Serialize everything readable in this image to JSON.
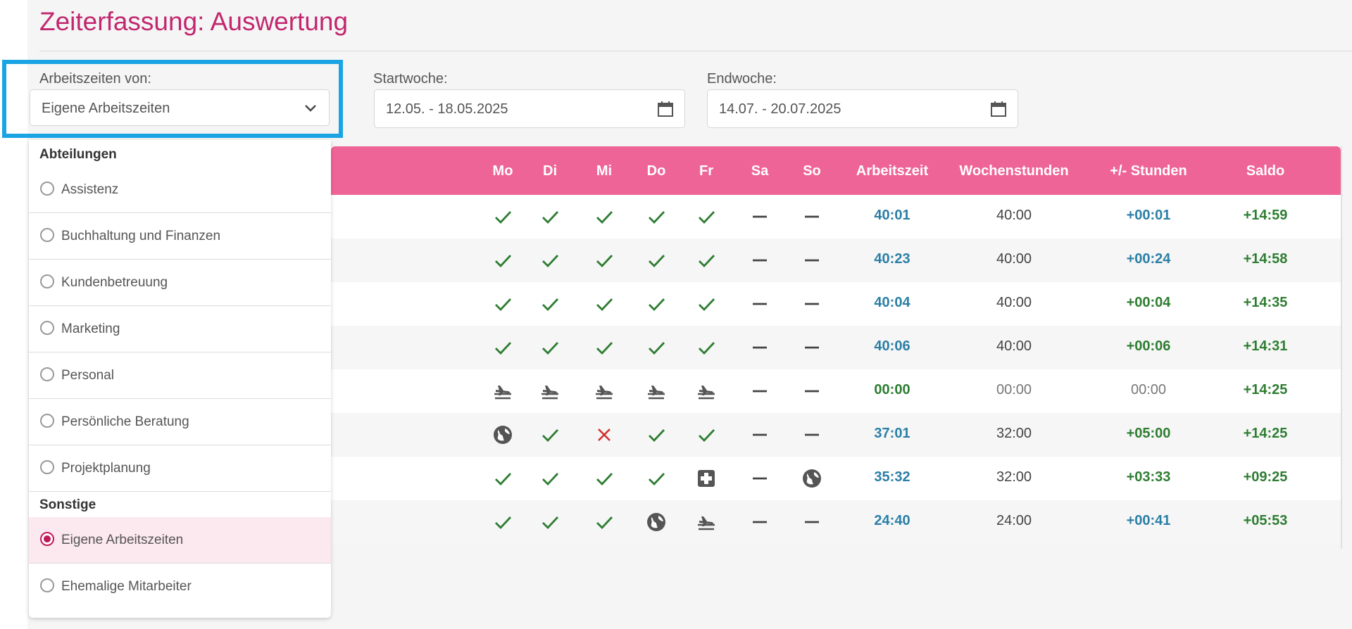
{
  "page": {
    "title": "Zeiterfassung: Auswertung"
  },
  "filters": {
    "arbeitszeiten_label": "Arbeitszeiten von:",
    "arbeitszeiten_value": "Eigene Arbeitszeiten",
    "startwoche_label": "Startwoche:",
    "startwoche_value": "12.05. - 18.05.2025",
    "endwoche_label": "Endwoche:",
    "endwoche_value": "14.07. - 20.07.2025"
  },
  "dropdown": {
    "groups": [
      {
        "label": "Abteilungen",
        "options": [
          "Assistenz",
          "Buchhaltung und Finanzen",
          "Kundenbetreuung",
          "Marketing",
          "Personal",
          "Persönliche Beratung",
          "Projektplanung"
        ]
      },
      {
        "label": "Sonstige",
        "options": [
          "Eigene Arbeitszeiten",
          "Ehemalige Mitarbeiter"
        ]
      }
    ],
    "selected": "Eigene Arbeitszeiten"
  },
  "table": {
    "headers": [
      "Mo",
      "Di",
      "Mi",
      "Do",
      "Fr",
      "Sa",
      "So",
      "Arbeitszeit",
      "Wochenstunden",
      "+/- Stunden",
      "Saldo"
    ],
    "rows": [
      {
        "days": [
          "check",
          "check",
          "check",
          "check",
          "check",
          "dash",
          "dash"
        ],
        "arbeitszeit": "40:01",
        "wochenstunden": "40:00",
        "diff": "+00:01",
        "diff_color": "blue",
        "saldo": "+14:59"
      },
      {
        "days": [
          "check",
          "check",
          "check",
          "check",
          "check",
          "dash",
          "dash"
        ],
        "arbeitszeit": "40:23",
        "wochenstunden": "40:00",
        "diff": "+00:24",
        "diff_color": "blue",
        "saldo": "+14:58"
      },
      {
        "days": [
          "check",
          "check",
          "check",
          "check",
          "check",
          "dash",
          "dash"
        ],
        "arbeitszeit": "40:04",
        "wochenstunden": "40:00",
        "diff": "+00:04",
        "diff_color": "green",
        "saldo": "+14:35"
      },
      {
        "days": [
          "check",
          "check",
          "check",
          "check",
          "check",
          "dash",
          "dash"
        ],
        "arbeitszeit": "40:06",
        "wochenstunden": "40:00",
        "diff": "+00:06",
        "diff_color": "green",
        "saldo": "+14:31"
      },
      {
        "days": [
          "vacation",
          "vacation",
          "vacation",
          "vacation",
          "vacation",
          "dash",
          "dash"
        ],
        "arbeitszeit": "00:00",
        "arbeitszeit_color": "green",
        "wochenstunden": "00:00",
        "wochenstunden_muted": true,
        "diff": "00:00",
        "diff_color": "muted",
        "saldo": "+14:25"
      },
      {
        "days": [
          "globe",
          "check",
          "cross",
          "check",
          "check",
          "dash",
          "dash"
        ],
        "arbeitszeit": "37:01",
        "wochenstunden": "32:00",
        "diff": "+05:00",
        "diff_color": "green",
        "saldo": "+14:25"
      },
      {
        "days": [
          "check",
          "check",
          "check",
          "check",
          "sick",
          "dash",
          "globe"
        ],
        "arbeitszeit": "35:32",
        "wochenstunden": "32:00",
        "diff": "+03:33",
        "diff_color": "green",
        "saldo": "+09:25"
      },
      {
        "days": [
          "check",
          "check",
          "check",
          "globe",
          "vacation",
          "dash",
          "dash"
        ],
        "arbeitszeit": "24:40",
        "wochenstunden": "24:00",
        "diff": "+00:41",
        "diff_color": "blue",
        "saldo": "+05:53"
      }
    ]
  },
  "colors": {
    "brand": "#c2276f",
    "header_bg": "#ef6496",
    "highlight": "#1aa4e3",
    "check": "#2e7d32",
    "cross": "#d32f2f"
  }
}
